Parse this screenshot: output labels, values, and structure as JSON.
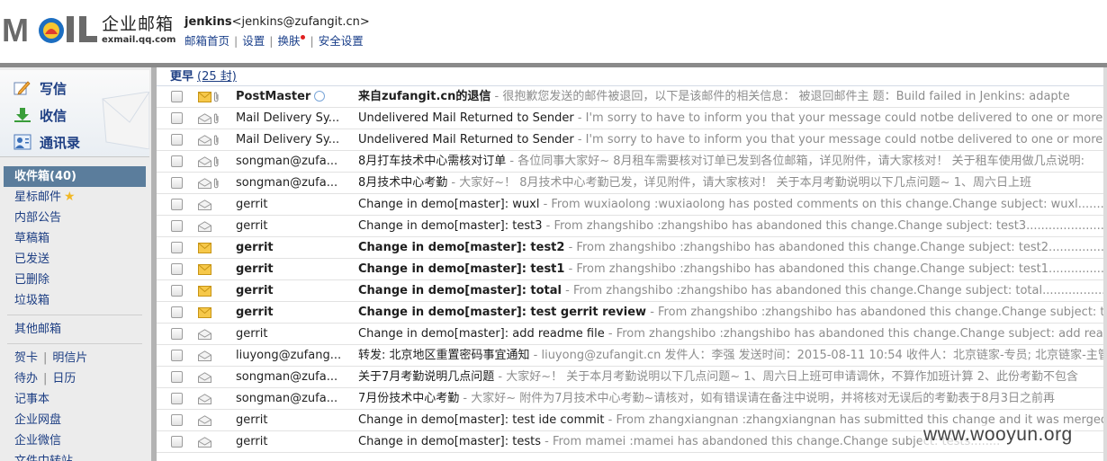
{
  "header": {
    "brand_cn": "企业邮箱",
    "brand_en": "exmail.qq.com",
    "user_name": "jenkins",
    "user_email": "<jenkins@zufangit.cn>",
    "links": [
      "邮箱首页",
      "设置",
      "换肤",
      "安全设置"
    ]
  },
  "sidebar": {
    "compose_label": "写信",
    "receive_label": "收信",
    "contacts_label": "通讯录",
    "inbox_label": "收件箱(40)",
    "folders": [
      "星标邮件",
      "内部公告",
      "草稿箱",
      "已发送",
      "已删除",
      "垃圾箱"
    ],
    "other_mailbox": "其他邮箱",
    "tools": {
      "card": "贺卡",
      "postcard": "明信片",
      "todo": "待办",
      "calendar": "日历",
      "notes": "记事本",
      "disk": "企业网盘",
      "wechat": "企业微信",
      "transfer": "文件中转站"
    }
  },
  "list": {
    "group_label": "更早",
    "group_count": "(25 封)",
    "rows": [
      {
        "sender": "PostMaster",
        "subject": "来自zufangit.cn的退信",
        "preview": " - 很抱歉您发送的邮件被退回，以下是该邮件的相关信息： 被退回邮件主 题：Build failed in Jenkins: adapte"
      },
      {
        "sender": "Mail Delivery Sy...",
        "subject": "Undelivered Mail Returned to Sender",
        "preview": " - I'm sorry to have to inform you that your message could notbe delivered to one or more recip"
      },
      {
        "sender": "Mail Delivery Sy...",
        "subject": "Undelivered Mail Returned to Sender",
        "preview": " - I'm sorry to have to inform you that your message could notbe delivered to one or more recip"
      },
      {
        "sender": "songman@zufa...",
        "subject": "8月打车技术中心需核对订单",
        "preview": " - 各位同事大家好~ 8月租车需要核对订单已发到各位邮箱，详见附件，请大家核对！ 关于租车使用做几点说明:"
      },
      {
        "sender": "songman@zufa...",
        "subject": "8月技术中心考勤",
        "preview": " - 大家好~！ 8月技术中心考勤已发，详见附件，请大家核对！ 关于本月考勤说明以下几点问题~ 1、周六日上班"
      },
      {
        "sender": "gerrit",
        "subject": "Change in demo[master]: wuxl",
        "preview": " - From wuxiaolong :wuxiaolong has posted comments on this change.Change subject: wuxl..............."
      },
      {
        "sender": "gerrit",
        "subject": "Change in demo[master]: test3",
        "preview": " - From zhangshibo :zhangshibo has abandoned this change.Change subject: test3........................"
      },
      {
        "sender": "gerrit",
        "subject": "Change in demo[master]: test2",
        "preview": " - From zhangshibo :zhangshibo has abandoned this change.Change subject: test2........................"
      },
      {
        "sender": "gerrit",
        "subject": "Change in demo[master]: test1",
        "preview": " - From zhangshibo :zhangshibo has abandoned this change.Change subject: test1........................"
      },
      {
        "sender": "gerrit",
        "subject": "Change in demo[master]: total",
        "preview": " - From zhangshibo :zhangshibo has abandoned this change.Change subject: total......................."
      },
      {
        "sender": "gerrit",
        "subject": "Change in demo[master]: test gerrit review",
        "preview": " - From zhangshibo :zhangshibo has abandoned this change.Change subject: test ger"
      },
      {
        "sender": "gerrit",
        "subject": "Change in demo[master]: add readme file",
        "preview": " - From zhangshibo :zhangshibo has abandoned this change.Change subject: add readme"
      },
      {
        "sender": "liuyong@zufang...",
        "subject": "转发: 北京地区重置密码事宜通知",
        "preview": " - liuyong@zufangit.cn 发件人：李强 发送时间：2015-08-11 10:54 收件人：北京链家-专员; 北京链家-主管;"
      },
      {
        "sender": "songman@zufa...",
        "subject": "关于7月考勤说明几点问题",
        "preview": " - 大家好~！ 关于本月考勤说明以下几点问题~ 1、周六日上班可申请调休，不算作加班计算 2、此份考勤不包含"
      },
      {
        "sender": "songman@zufa...",
        "subject": "7月份技术中心考勤",
        "preview": " - 大家好~ 附件为7月技术中心考勤~请核对，如有错误请在备注中说明，并将核对无误后的考勤表于8月3日之前再"
      },
      {
        "sender": "gerrit",
        "subject": "Change in demo[master]: test ide commit",
        "preview": " - From zhangxiangnan :zhangxiangnan has submitted this change and it was merged.Cha"
      },
      {
        "sender": "gerrit",
        "subject": "Change in demo[master]: tests",
        "preview": " - From mamei :mamei has abandoned this change.Change subject: tests........"
      }
    ]
  },
  "watermark": "www.wooyun.org"
}
